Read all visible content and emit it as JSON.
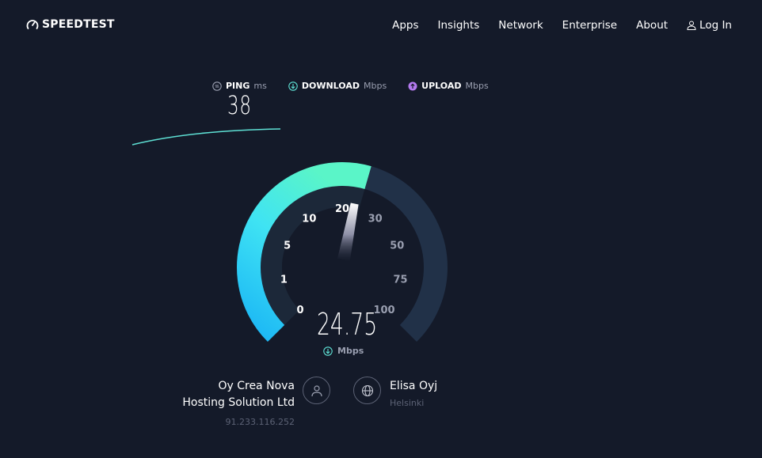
{
  "brand": {
    "name": "SPEEDTEST",
    "logo_icon": "speedometer-icon"
  },
  "nav": {
    "items": [
      "Apps",
      "Insights",
      "Network",
      "Enterprise",
      "About"
    ],
    "login": "Log In"
  },
  "metrics": {
    "ping": {
      "label": "PING",
      "unit": "ms",
      "value": "38"
    },
    "download": {
      "label": "DOWNLOAD",
      "unit": "Mbps"
    },
    "upload": {
      "label": "UPLOAD",
      "unit": "Mbps"
    }
  },
  "gauge": {
    "ticks": [
      "0",
      "1",
      "5",
      "10",
      "20",
      "30",
      "50",
      "75",
      "100"
    ],
    "current_value": "24.75",
    "current_numeric": 24.75,
    "unit": "Mbps",
    "colors": {
      "fill_start": "#1bb6f5",
      "fill_end": "#5af5c8",
      "track": "#213148"
    }
  },
  "isp": {
    "name_line1": "Oy Crea Nova",
    "name_line2": "Hosting Solution Ltd",
    "ip": "91.233.116.252"
  },
  "server": {
    "name": "Elisa Oyj",
    "city": "Helsinki"
  },
  "colors": {
    "background": "#141a29",
    "download": "#5ee0d4",
    "upload": "#b47af0",
    "ping": "#9a9fb0"
  }
}
